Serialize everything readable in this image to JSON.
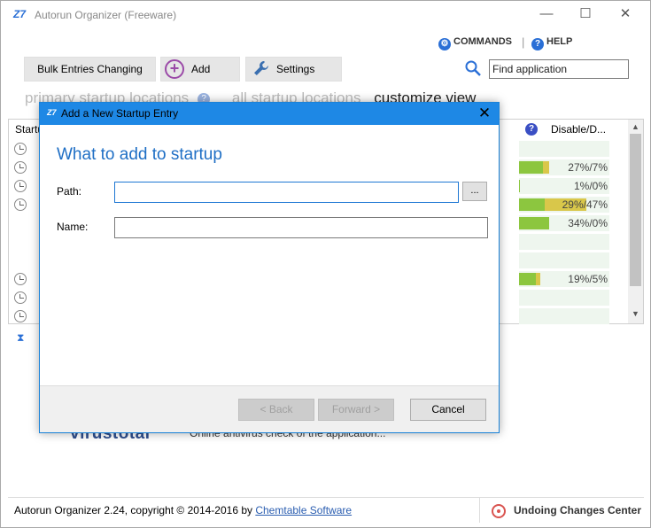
{
  "window": {
    "title": "Autorun Organizer (Freeware)",
    "minimize": "—",
    "maximize": "☐",
    "close": "✕"
  },
  "header": {
    "commands": "COMMANDS",
    "separator": "|",
    "help": "HELP"
  },
  "toolbar": {
    "bulk": "Bulk Entries Changing",
    "add": "Add",
    "settings": "Settings",
    "search_placeholder": "Find application"
  },
  "view_tabs": {
    "primary": "primary startup locations",
    "all": "all startup locations",
    "customize": "customize view"
  },
  "list": {
    "col_startup": "Startu",
    "col_disable": "Disable/D...",
    "rows": [
      {
        "disable_pct": 0.0,
        "delay_pct": 0.0,
        "label": ""
      },
      {
        "disable_pct": 27,
        "delay_pct": 7,
        "label": "27%/7%"
      },
      {
        "disable_pct": 1,
        "delay_pct": 0,
        "label": "1%/0%"
      },
      {
        "disable_pct": 29,
        "delay_pct": 47,
        "label": "29%/47%"
      },
      {
        "disable_pct": 34,
        "delay_pct": 0,
        "label": "34%/0%"
      },
      {
        "disable_pct": 0,
        "delay_pct": 0,
        "label": ""
      },
      {
        "disable_pct": 0,
        "delay_pct": 0,
        "label": ""
      },
      {
        "disable_pct": 19,
        "delay_pct": 5,
        "label": "19%/5%"
      },
      {
        "disable_pct": 0,
        "delay_pct": 0,
        "label": ""
      },
      {
        "disable_pct": 0,
        "delay_pct": 0,
        "label": ""
      }
    ]
  },
  "bottom": {
    "virustotal_logo": "virustotal",
    "virustotal_text": "Online antivirus check of the application..."
  },
  "status": {
    "copyright": "Autorun Organizer 2.24, copyright © 2014-2016 by ",
    "link": "Chemtable Software",
    "undo": "Undoing Changes Center"
  },
  "dialog": {
    "title": "Add a New Startup Entry",
    "close": "✕",
    "heading": "What to add to startup",
    "path_label": "Path:",
    "path_value": "",
    "browse": "...",
    "name_label": "Name:",
    "name_value": "",
    "back": "< Back",
    "forward": "Forward >",
    "cancel": "Cancel"
  },
  "colors": {
    "accent": "#1e88e5",
    "heading": "#1f6fc5",
    "bar_green": "#8cc63f",
    "bar_yellow": "#d9c74a"
  }
}
